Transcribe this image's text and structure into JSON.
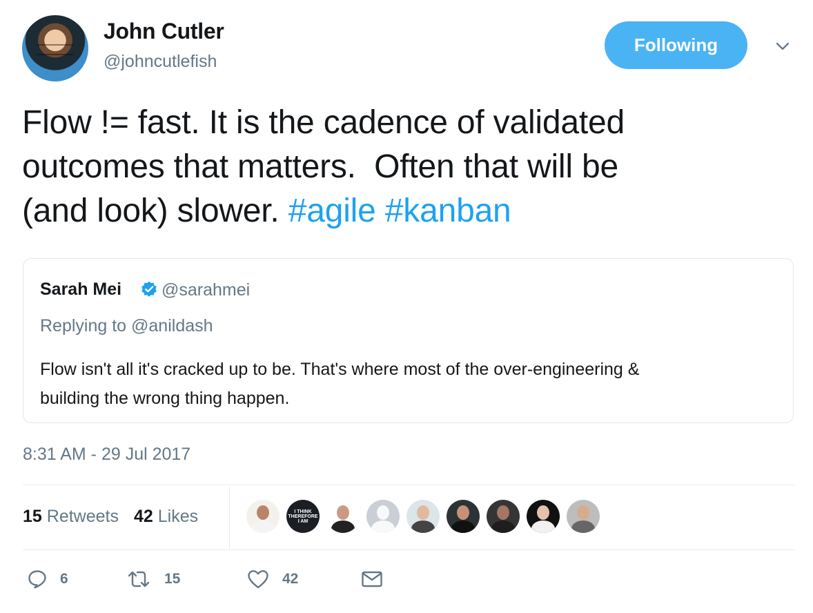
{
  "author": {
    "name": "John Cutler",
    "handle": "@johncutlefish",
    "follow_label": "Following",
    "menu_icon": "chevron-down-icon"
  },
  "tweet": {
    "text": "Flow != fast. It is the cadence of validated\noutcomes that matters.  Often that will be\n(and look) slower. ",
    "hashtags": [
      "#agile",
      "#kanban"
    ]
  },
  "quoted_tweet": {
    "name": "Sarah Mei",
    "handle": "@sarahmei",
    "reply_context": "Replying to @anildash",
    "text": "Flow isn't all it's cracked up to be. That's where most of the over-engineering &\nbuilding the wrong thing happen."
  },
  "timestamp": "8:31 AM - 29 Jul 2017",
  "stats": {
    "retweets_count": "15",
    "retweets_label": "Retweets",
    "likes_count": "42",
    "likes_label": "Likes"
  },
  "avatar_overlay": {
    "think_text": "I THINK\nTHEREFORE\nI AM"
  },
  "actions": {
    "reply_count": "6",
    "retweet_count": "15",
    "like_count": "42"
  },
  "colors": {
    "accent": "#1da1f2",
    "button": "#4ab3f4",
    "text": "#14171a",
    "muted": "#657786"
  }
}
